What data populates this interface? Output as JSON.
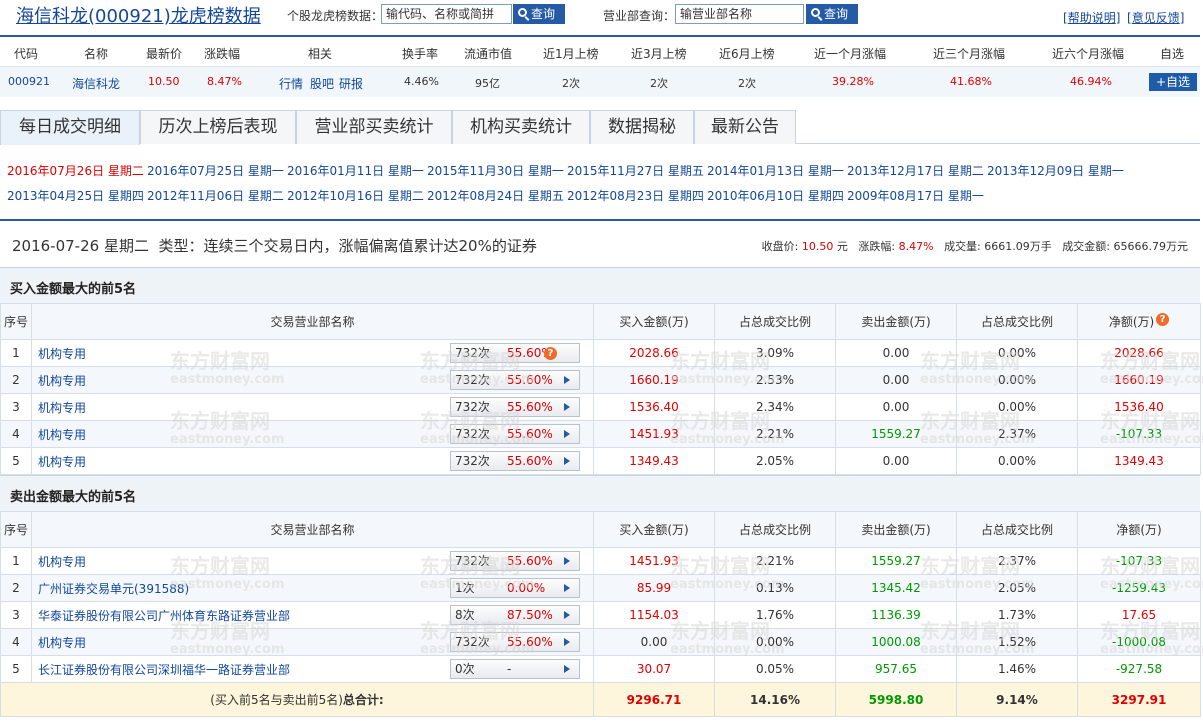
{
  "header": {
    "title": "海信科龙(000921)龙虎榜数据",
    "stock_query_label": "个股龙虎榜数据：",
    "stock_query_placeholder": "输代码、名称或简拼",
    "query_button": "查询",
    "dept_query_label": "营业部查询：",
    "dept_query_placeholder": "输营业部名称",
    "help_link": "帮助说明",
    "feedback_link": "意见反馈"
  },
  "stock_info": {
    "headers": [
      "代码",
      "名称",
      "最新价",
      "涨跌幅",
      "相关",
      "换手率",
      "流通市值",
      "近1月上榜",
      "近3月上榜",
      "近6月上榜",
      "近一个月涨幅",
      "近三个月涨幅",
      "近六个月涨幅",
      "自选"
    ],
    "code": "000921",
    "name": "海信科龙",
    "price": "10.50",
    "change": "8.47%",
    "related": [
      "行情",
      "股吧",
      "研报"
    ],
    "turnover": "4.46%",
    "float_cap": "95亿",
    "m1_list": "2次",
    "m3_list": "2次",
    "m6_list": "2次",
    "m1_gain": "39.28%",
    "m3_gain": "41.68%",
    "m6_gain": "46.94%",
    "add_button": "+自选"
  },
  "tabs": [
    "每日成交明细",
    "历次上榜后表现",
    "营业部买卖统计",
    "机构买卖统计",
    "数据揭秘",
    "最新公告"
  ],
  "dates": [
    "2016年07月26日 星期二",
    "2016年07月25日 星期一",
    "2016年01月11日 星期一",
    "2015年11月30日 星期一",
    "2015年11月27日 星期五",
    "2014年01月13日 星期一",
    "2013年12月17日 星期二",
    "2013年12月09日 星期一",
    "2013年04月25日 星期四",
    "2012年11月06日 星期二",
    "2012年10月16日 星期二",
    "2012年08月24日 星期五",
    "2012年08月23日 星期四",
    "2010年06月10日 星期四",
    "2009年08月17日 星期一"
  ],
  "summary": {
    "date": "2016-07-26 星期二",
    "type_label": "类型：",
    "type": "连续三个交易日内，涨幅偏离值累计达20%的证券",
    "close_label": "收盘价:",
    "close": "10.50",
    "close_unit": "元",
    "change_label": "涨跌幅:",
    "change": "8.47%",
    "volume_label": "成交量:",
    "volume": "6661.09万手",
    "amount_label": "成交金额:",
    "amount": "65666.79万元"
  },
  "buy_section": {
    "title": "买入金额最大的前5名",
    "headers": [
      "序号",
      "交易营业部名称",
      "买入金额(万)",
      "占总成交比例",
      "卖出金额(万)",
      "占总成交比例",
      "净额(万)"
    ],
    "rows": [
      {
        "no": "1",
        "name": "机构专用",
        "times": "732次",
        "win": "55.60%",
        "buy": "2028.66",
        "buy_pct": "3.09%",
        "sell": "0.00",
        "sell_pct": "0.00%",
        "net": "2028.66"
      },
      {
        "no": "2",
        "name": "机构专用",
        "times": "732次",
        "win": "55.60%",
        "buy": "1660.19",
        "buy_pct": "2.53%",
        "sell": "0.00",
        "sell_pct": "0.00%",
        "net": "1660.19"
      },
      {
        "no": "3",
        "name": "机构专用",
        "times": "732次",
        "win": "55.60%",
        "buy": "1536.40",
        "buy_pct": "2.34%",
        "sell": "0.00",
        "sell_pct": "0.00%",
        "net": "1536.40"
      },
      {
        "no": "4",
        "name": "机构专用",
        "times": "732次",
        "win": "55.60%",
        "buy": "1451.93",
        "buy_pct": "2.21%",
        "sell": "1559.27",
        "sell_pct": "2.37%",
        "net": "-107.33"
      },
      {
        "no": "5",
        "name": "机构专用",
        "times": "732次",
        "win": "55.60%",
        "buy": "1349.43",
        "buy_pct": "2.05%",
        "sell": "0.00",
        "sell_pct": "0.00%",
        "net": "1349.43"
      }
    ]
  },
  "sell_section": {
    "title": "卖出金额最大的前5名",
    "headers": [
      "序号",
      "交易营业部名称",
      "买入金额(万)",
      "占总成交比例",
      "卖出金额(万)",
      "占总成交比例",
      "净额(万)"
    ],
    "rows": [
      {
        "no": "1",
        "name": "机构专用",
        "times": "732次",
        "win": "55.60%",
        "buy": "1451.93",
        "buy_pct": "2.21%",
        "sell": "1559.27",
        "sell_pct": "2.37%",
        "net": "-107.33"
      },
      {
        "no": "2",
        "name": "广州证券交易单元(391588)",
        "times": "1次",
        "win": "0.00%",
        "buy": "85.99",
        "buy_pct": "0.13%",
        "sell": "1345.42",
        "sell_pct": "2.05%",
        "net": "-1259.43"
      },
      {
        "no": "3",
        "name": "华泰证券股份有限公司广州体育东路证券营业部",
        "times": "8次",
        "win": "87.50%",
        "buy": "1154.03",
        "buy_pct": "1.76%",
        "sell": "1136.39",
        "sell_pct": "1.73%",
        "net": "17.65"
      },
      {
        "no": "4",
        "name": "机构专用",
        "times": "732次",
        "win": "55.60%",
        "buy": "0.00",
        "buy_pct": "0.00%",
        "sell": "1000.08",
        "sell_pct": "1.52%",
        "net": "-1000.08"
      },
      {
        "no": "5",
        "name": "长江证券股份有限公司深圳福华一路证券营业部",
        "times": "0次",
        "win": "-",
        "buy": "30.07",
        "buy_pct": "0.05%",
        "sell": "957.65",
        "sell_pct": "1.46%",
        "net": "-927.58"
      }
    ],
    "total": {
      "label_prefix": "(买入前5名与卖出前5名)",
      "label_bold": "总合计:",
      "buy": "9296.71",
      "buy_pct": "14.16%",
      "sell": "5998.80",
      "sell_pct": "9.14%",
      "net": "3297.91"
    }
  },
  "watermark": {
    "cn": "东方财富网",
    "en": "eastmoney.com"
  },
  "colors": {
    "accent": "#245aa6",
    "up": "#e00000",
    "down": "#009900",
    "link": "#12479b"
  }
}
